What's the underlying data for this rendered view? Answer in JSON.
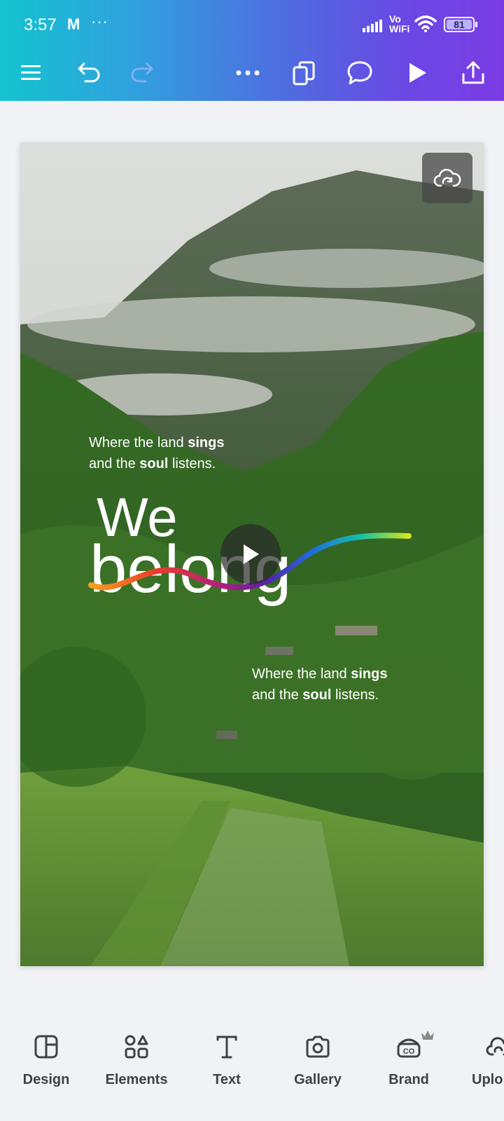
{
  "status_bar": {
    "time": "3:57",
    "notification_app": "M",
    "more_dots": "···",
    "network_label_top": "Vo",
    "network_label_bottom": "WiFi",
    "battery_level": "81"
  },
  "toolbar": {
    "icons": [
      "menu-icon",
      "undo-icon",
      "redo-icon",
      "more-icon",
      "pages-icon",
      "comment-icon",
      "play-icon",
      "share-icon"
    ]
  },
  "canvas": {
    "tagline_1_line1_pre": "Where the land ",
    "tagline_1_line1_bold": "sings",
    "tagline_1_line2_pre": "and the ",
    "tagline_1_line2_bold": "soul",
    "tagline_1_line2_post": " listens.",
    "tagline_2_line1_pre": "Where the land ",
    "tagline_2_line1_bold": "sings",
    "tagline_2_line2_pre": "and the ",
    "tagline_2_line2_bold": "soul",
    "tagline_2_line2_post": " listens.",
    "logo_word_1": "We",
    "logo_word_2": "belong"
  },
  "bottom_nav": {
    "items": [
      {
        "label": "Design",
        "icon": "design-icon"
      },
      {
        "label": "Elements",
        "icon": "elements-icon"
      },
      {
        "label": "Text",
        "icon": "text-icon"
      },
      {
        "label": "Gallery",
        "icon": "camera-icon"
      },
      {
        "label": "Brand",
        "icon": "brand-icon"
      },
      {
        "label": "Uplo",
        "icon": "upload-icon"
      }
    ]
  }
}
